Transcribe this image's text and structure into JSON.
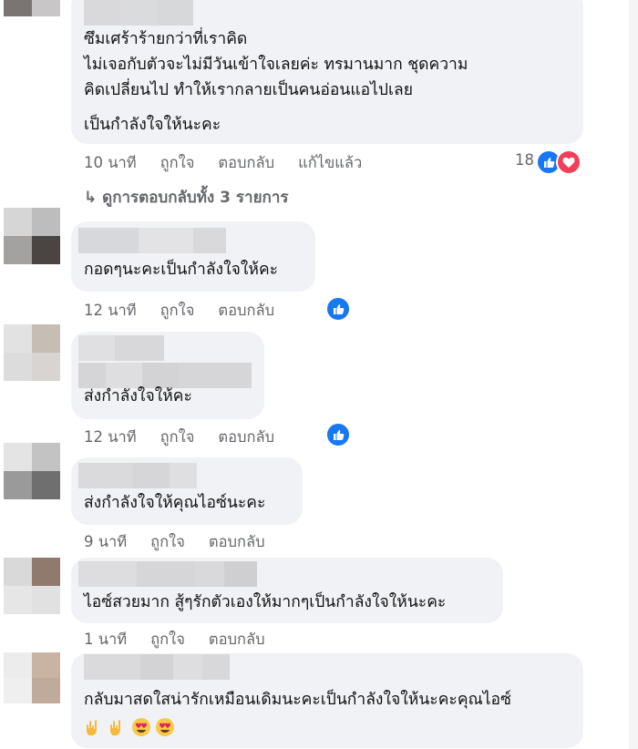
{
  "comments": [
    {
      "lines": [
        "ซึมเศร้าร้ายกว่าที่เราคิด",
        "ไม่เจอกับตัวจะไม่มีวันเข้าใจเลยค่ะ ทรมานมาก ชุดความ",
        "คิดเปลี่ยนไป ทำให้เรากลายเป็นคนอ่อนแอไปเลย",
        "เป็นกำลังใจให้นะคะ"
      ],
      "time": "10 นาที",
      "like": "ถูกใจ",
      "reply": "ตอบกลับ",
      "edited": "แก้ไขแล้ว",
      "reaction_count": "18",
      "view_replies": "ดูการตอบกลับทั้ง 3 รายการ"
    },
    {
      "lines": [
        "กอดๆนะคะเป็นกำลังใจให้คะ"
      ],
      "time": "12 นาที",
      "like": "ถูกใจ",
      "reply": "ตอบกลับ"
    },
    {
      "lines": [
        "ส่งกำลังใจให้คะ"
      ],
      "time": "12 นาที",
      "like": "ถูกใจ",
      "reply": "ตอบกลับ"
    },
    {
      "lines": [
        "ส่งกำลังใจให้คุณไอซ์นะคะ"
      ],
      "time": "9 นาที",
      "like": "ถูกใจ",
      "reply": "ตอบกลับ"
    },
    {
      "lines": [
        "ไอซ์สวยมาก สู้ๆรักตัวเองให้มากๆเป็นกำลังใจให้นะคะ"
      ],
      "time": "1 นาที",
      "like": "ถูกใจ",
      "reply": "ตอบกลับ"
    },
    {
      "lines": [
        "กลับมาสดใสน่ารักเหมือนเดิมนะคะเป็นกำลังใจให้นะคะคุณไอซ์"
      ],
      "emojis": [
        "hand-horns-emoji",
        "hand-horns-emoji",
        "heart-eyes-emoji",
        "heart-eyes-emoji"
      ]
    }
  ],
  "colors": {
    "bubble": "#f0f2f5",
    "meta": "#65676b",
    "like_blue": "#1877f2",
    "heart_red": "#f33e58"
  }
}
